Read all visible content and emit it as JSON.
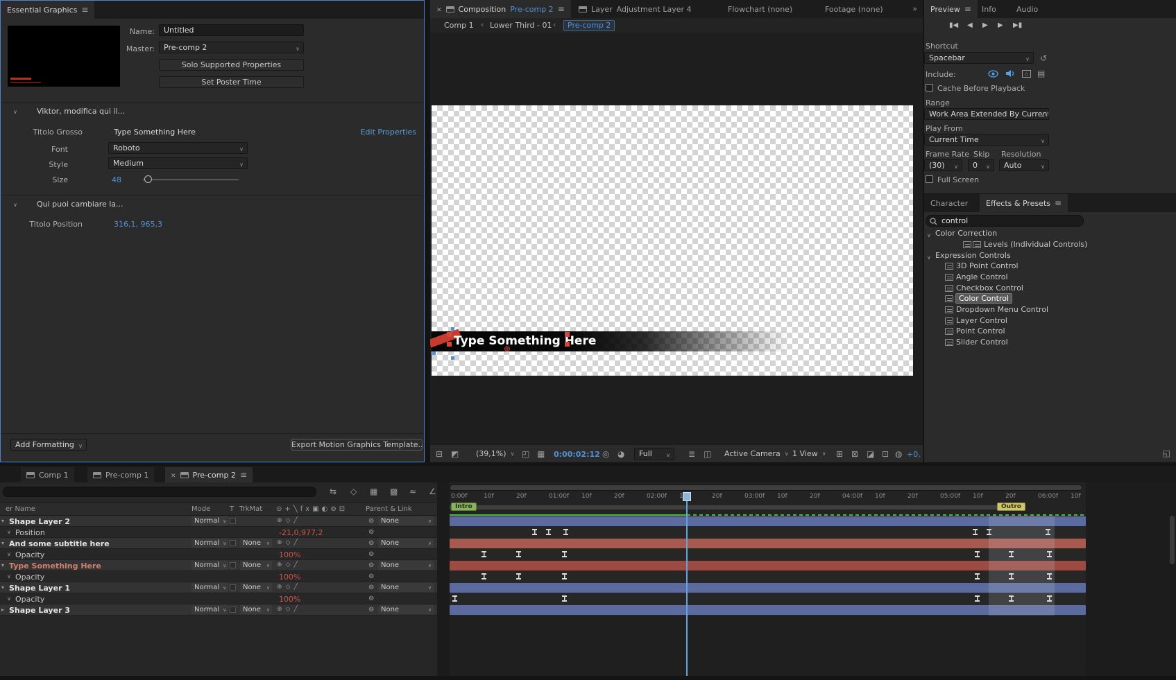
{
  "icons": {
    "menu-icon": "≡",
    "close-icon": "✕",
    "chevron-down-icon": "∨",
    "twirl-down-icon": "∨",
    "breadcrumb-separator-icon": "‹",
    "tab-overflow-icon": "»",
    "search-icon": "magnifier",
    "eye-icon": "eye",
    "audio-icon": "speaker",
    "reset-icon": "↺",
    "keyframe-icon": "i-beam",
    "pick-whip-icon": "⊚",
    "anchor-crosshair-icon": "⊕"
  },
  "essential_graphics": {
    "title": "Essential Graphics",
    "name_label": "Name:",
    "name_value": "Untitled",
    "master_label": "Master:",
    "master_value": "Pre-comp 2",
    "solo_supported_button": "Solo Supported Properties",
    "set_poster_button": "Set Poster Time",
    "group1_title": "Viktor, modifica qui il...",
    "titolo_grosso_label": "Titolo Grosso",
    "titolo_grosso_value": "Type Something Here",
    "edit_properties_link": "Edit Properties",
    "font_label": "Font",
    "font_value": "Roboto",
    "style_label": "Style",
    "style_value": "Medium",
    "size_label": "Size",
    "size_value": "48",
    "group2_title": "Qui puoi cambiare la...",
    "titolo_position_label": "Titolo Position",
    "titolo_position_value": "316,1, 965,3",
    "add_formatting_button": "Add Formatting",
    "export_button": "Export Motion Graphics Template..."
  },
  "composition": {
    "tabs": [
      {
        "prefix": "Composition",
        "name": "Pre-comp 2",
        "active": true
      },
      {
        "prefix": "Layer",
        "name": "Adjustment Layer 4",
        "active": false
      },
      {
        "prefix": "Flowchart (none)",
        "name": "",
        "active": false
      },
      {
        "prefix": "Footage (none)",
        "name": "",
        "active": false
      }
    ],
    "breadcrumbs": {
      "items": [
        "Comp 1",
        "Lower Third - 01",
        "Pre-comp 2"
      ]
    },
    "canvas": {
      "title_text": "Type Something Here"
    },
    "toolbar": {
      "zoom": "(39,1%)",
      "timecode": "0:00:02:12",
      "resolution": "Full",
      "camera": "Active Camera",
      "view_layout": "1 View",
      "exposure": "+0,"
    }
  },
  "preview": {
    "tabs": {
      "preview": "Preview",
      "info": "Info",
      "audio": "Audio"
    },
    "shortcut_label": "Shortcut",
    "shortcut_value": "Spacebar",
    "include_label": "Include:",
    "cache_label": "Cache Before Playback",
    "range_label": "Range",
    "range_value": "Work Area Extended By Current ..",
    "play_from_label": "Play From",
    "play_from_value": "Current Time",
    "frame_rate_label": "Frame Rate",
    "skip_label": "Skip",
    "resolution_label": "Resolution",
    "frame_rate_value": "(30)",
    "skip_value": "0",
    "resolution_value": "Auto",
    "full_screen_label": "Full Screen"
  },
  "effects_presets": {
    "tabs": {
      "character": "Character",
      "effects": "Effects & Presets"
    },
    "search_value": "control",
    "groups": [
      {
        "name": "Color Correction",
        "items": [
          {
            "label": "Levels (Individual Controls)",
            "selected": false
          }
        ]
      },
      {
        "name": "Expression Controls",
        "items": [
          {
            "label": "3D Point Control",
            "selected": false
          },
          {
            "label": "Angle Control",
            "selected": false
          },
          {
            "label": "Checkbox Control",
            "selected": false
          },
          {
            "label": "Color Control",
            "selected": true
          },
          {
            "label": "Dropdown Menu Control",
            "selected": false
          },
          {
            "label": "Layer Control",
            "selected": false
          },
          {
            "label": "Point Control",
            "selected": false
          },
          {
            "label": "Slider Control",
            "selected": false
          }
        ]
      }
    ]
  },
  "timeline": {
    "tabs": [
      {
        "name": "Comp 1",
        "active": false
      },
      {
        "name": "Pre-comp 1",
        "active": false
      },
      {
        "name": "Pre-comp 2",
        "active": true
      }
    ],
    "columns": {
      "layer_name": "er Name",
      "mode": "Mode",
      "t": "T",
      "trkmat": "TrkMat",
      "parent": "Parent & Link"
    },
    "rows": [
      {
        "kind": "layer",
        "name": "Shape Layer 2",
        "mode": "Normal",
        "parent": "None",
        "bar": "blue"
      },
      {
        "kind": "prop",
        "name": "Position",
        "value": "-21,0,977,2"
      },
      {
        "kind": "layer",
        "name": "And some subtitle here",
        "mode": "Normal",
        "trkmat": "None",
        "parent": "None",
        "bar": "salmon"
      },
      {
        "kind": "prop",
        "name": "Opacity",
        "value": "100%"
      },
      {
        "kind": "layer",
        "name": "Type Something Here",
        "mode": "Normal",
        "trkmat": "None",
        "parent": "None",
        "bar": "red"
      },
      {
        "kind": "prop",
        "name": "Opacity",
        "value": "100%"
      },
      {
        "kind": "layer",
        "name": "Shape Layer 1",
        "mode": "Normal",
        "trkmat": "None",
        "parent": "None",
        "bar": "blue"
      },
      {
        "kind": "prop",
        "name": "Opacity",
        "value": "100%"
      },
      {
        "kind": "layer",
        "name": "Shape Layer 3",
        "mode": "Normal",
        "trkmat": "None",
        "parent": "None",
        "bar": "blue"
      }
    ],
    "ruler_labels": [
      "0:00f",
      "10f",
      "20f",
      "01:00f",
      "10f",
      "20f",
      "02:00f",
      "10f",
      "20f",
      "03:00f",
      "10f",
      "20f",
      "04:00f",
      "10f",
      "20f",
      "05:00f",
      "10f",
      "20f",
      "06:00f",
      "10f"
    ],
    "markers": {
      "intro": "Intro",
      "outro": "Outro"
    },
    "keyframes": {
      "position": [
        122,
        142,
        167,
        757,
        777,
        862
      ],
      "opacity_subtitle": [
        49,
        99,
        165,
        760,
        809,
        864
      ],
      "opacity_title": [
        49,
        99,
        165,
        760,
        809,
        864
      ],
      "opacity_shape1": [
        7,
        165,
        760,
        809,
        864
      ]
    }
  }
}
